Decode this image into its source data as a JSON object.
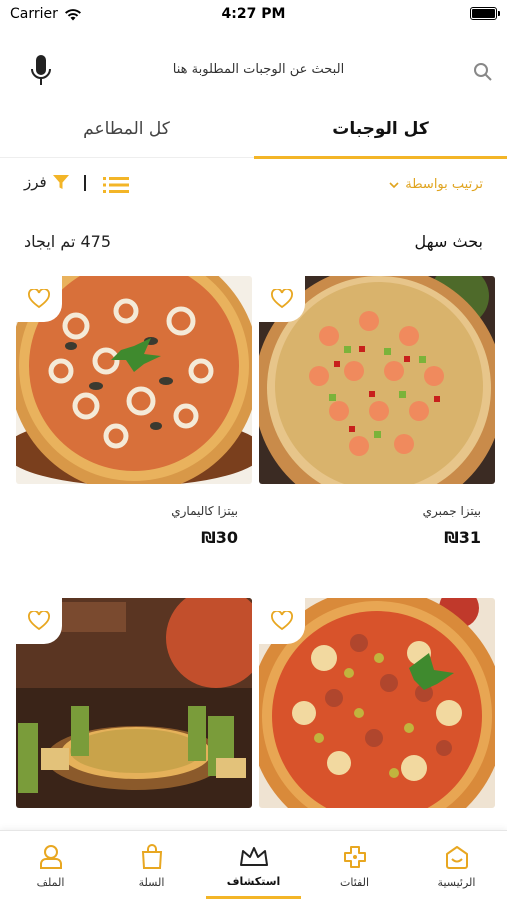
{
  "status": {
    "carrier": "Carrier",
    "time": "4:27 PM"
  },
  "search": {
    "placeholder": "البحث عن الوجبات المطلوبة هنا"
  },
  "tabs": {
    "all_meals": "كل الوجبات",
    "all_restaurants": "كل المطاعم"
  },
  "filters": {
    "filter_label": "فرز",
    "sort_label": "ترتيب بواسطة"
  },
  "results": {
    "count_text": "475 تم ايجاد",
    "easy_search": "بحث سهل"
  },
  "products": [
    {
      "name": "بيتزا جمبري",
      "price": "₪31"
    },
    {
      "name": "بيتزا كاليماري",
      "price": "₪30"
    },
    {
      "name": "",
      "price": ""
    },
    {
      "name": "",
      "price": ""
    }
  ],
  "nav": [
    {
      "label": "الرئيسية",
      "icon": "home-icon"
    },
    {
      "label": "الفئات",
      "icon": "categories-icon"
    },
    {
      "label": "استكشاف",
      "icon": "crown-icon"
    },
    {
      "label": "السلة",
      "icon": "bag-icon"
    },
    {
      "label": "الملف",
      "icon": "profile-icon"
    }
  ],
  "colors": {
    "accent": "#f3b527",
    "sort_text": "#e0a41f"
  }
}
